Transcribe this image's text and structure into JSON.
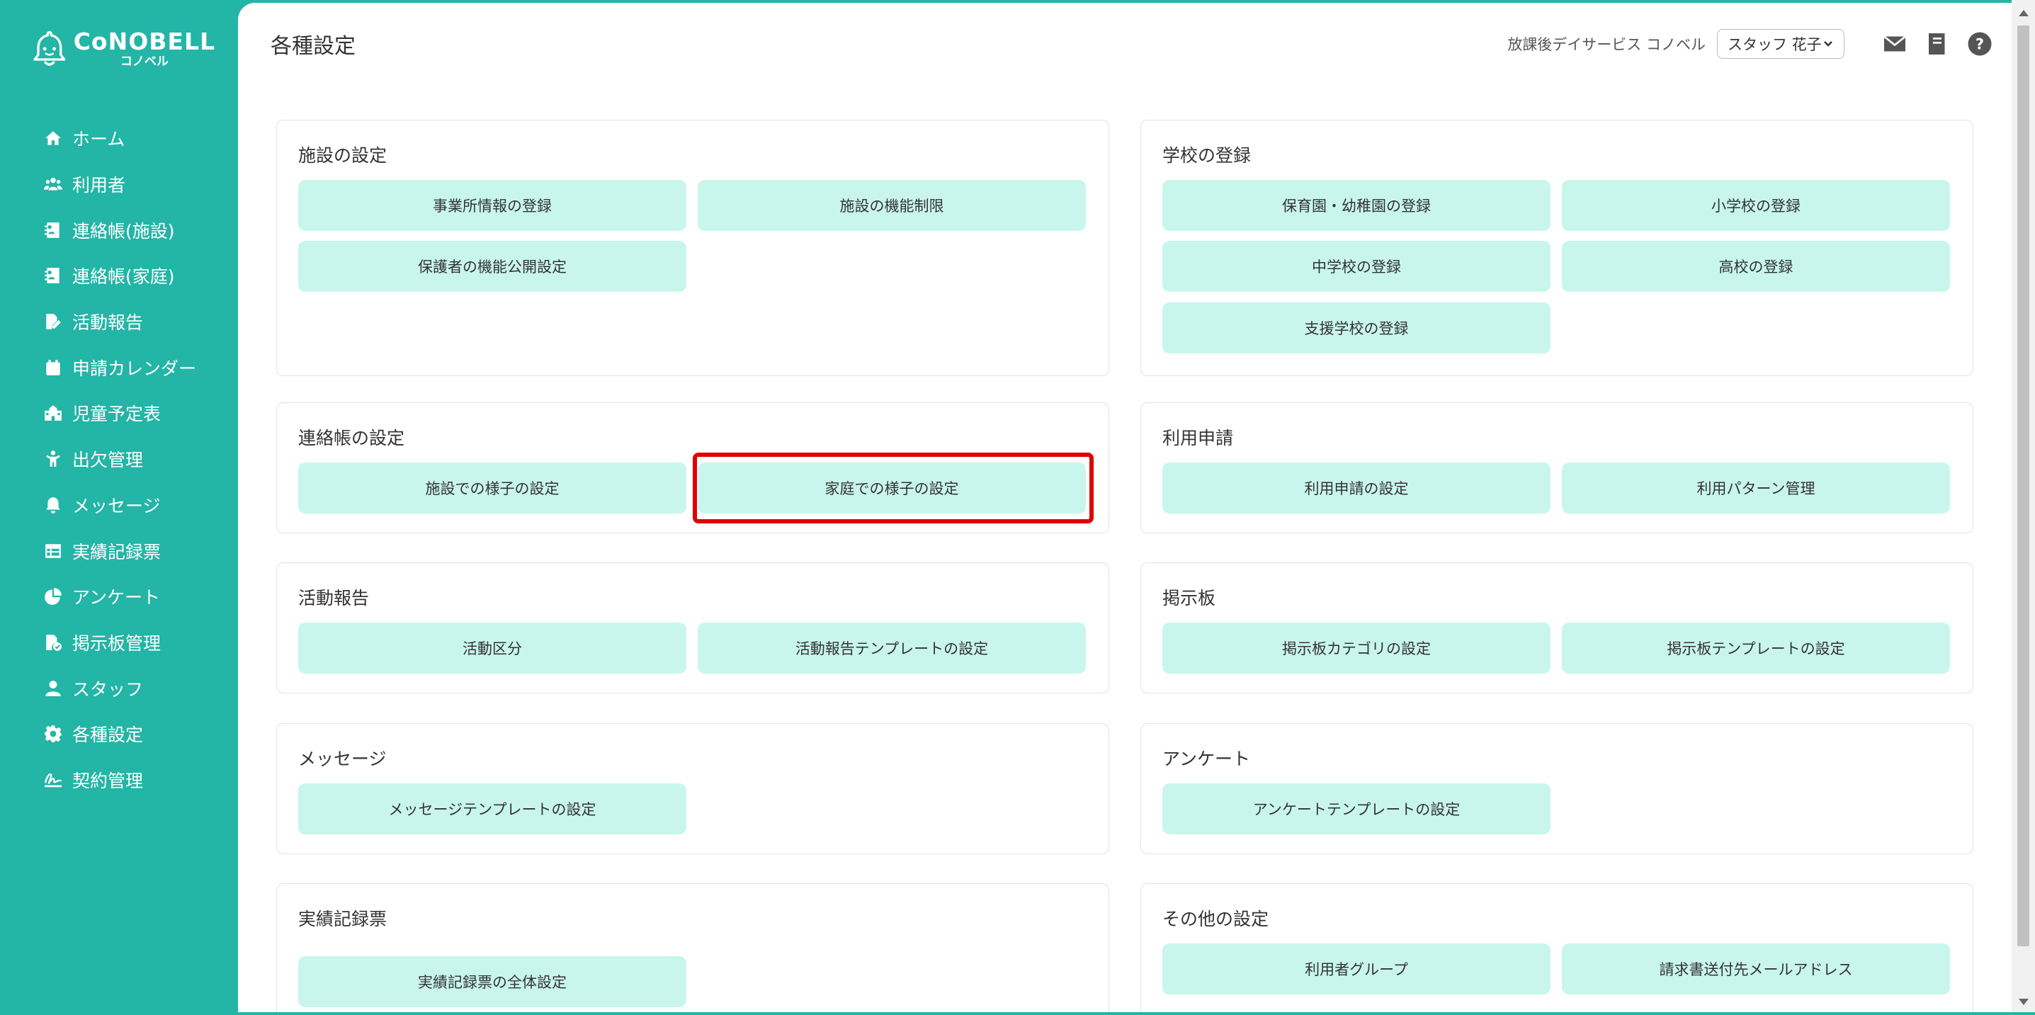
{
  "app": {
    "logo_main": "CoNOBELL",
    "logo_sub": "コノベル"
  },
  "sidebar": {
    "items": [
      {
        "label": "ホーム",
        "icon": "home-icon"
      },
      {
        "label": "利用者",
        "icon": "users-icon"
      },
      {
        "label": "連絡帳(施設)",
        "icon": "contact-book-icon"
      },
      {
        "label": "連絡帳(家庭)",
        "icon": "contact-book-icon"
      },
      {
        "label": "活動報告",
        "icon": "report-edit-icon"
      },
      {
        "label": "申請カレンダー",
        "icon": "calendar-icon"
      },
      {
        "label": "児童予定表",
        "icon": "school-building-icon"
      },
      {
        "label": "出欠管理",
        "icon": "child-icon"
      },
      {
        "label": "メッセージ",
        "icon": "bell-icon"
      },
      {
        "label": "実績記録票",
        "icon": "table-icon"
      },
      {
        "label": "アンケート",
        "icon": "pie-chart-icon"
      },
      {
        "label": "掲示板管理",
        "icon": "file-check-icon"
      },
      {
        "label": "スタッフ",
        "icon": "user-icon"
      },
      {
        "label": "各種設定",
        "icon": "gear-icon"
      },
      {
        "label": "契約管理",
        "icon": "signature-icon"
      }
    ]
  },
  "header": {
    "title": "各種設定",
    "facility_name": "放課後デイサービス コノベル",
    "staff_selected": "スタッフ 花子"
  },
  "cards": {
    "facility": {
      "title": "施設の設定",
      "buttons": [
        "事業所情報の登録",
        "施設の機能制限",
        "保護者の機能公開設定"
      ]
    },
    "school": {
      "title": "学校の登録",
      "buttons": [
        "保育園・幼稚園の登録",
        "小学校の登録",
        "中学校の登録",
        "高校の登録",
        "支援学校の登録"
      ]
    },
    "contact": {
      "title": "連絡帳の設定",
      "buttons": [
        "施設での様子の設定",
        "家庭での様子の設定"
      ]
    },
    "usage": {
      "title": "利用申請",
      "buttons": [
        "利用申請の設定",
        "利用パターン管理"
      ]
    },
    "activity": {
      "title": "活動報告",
      "buttons": [
        "活動区分",
        "活動報告テンプレートの設定"
      ]
    },
    "board": {
      "title": "掲示板",
      "buttons": [
        "掲示板カテゴリの設定",
        "掲示板テンプレートの設定"
      ]
    },
    "message": {
      "title": "メッセージ",
      "buttons": [
        "メッセージテンプレートの設定"
      ]
    },
    "survey": {
      "title": "アンケート",
      "buttons": [
        "アンケートテンプレートの設定"
      ]
    },
    "record": {
      "title": "実績記録票",
      "buttons": [
        "実績記録票の全体設定"
      ]
    },
    "other": {
      "title": "その他の設定",
      "buttons": [
        "利用者グループ",
        "請求書送付先メールアドレス"
      ]
    }
  },
  "colors": {
    "brand": "#23b5a6",
    "button_bg": "#c8f6ec",
    "highlight": "#e00000"
  }
}
